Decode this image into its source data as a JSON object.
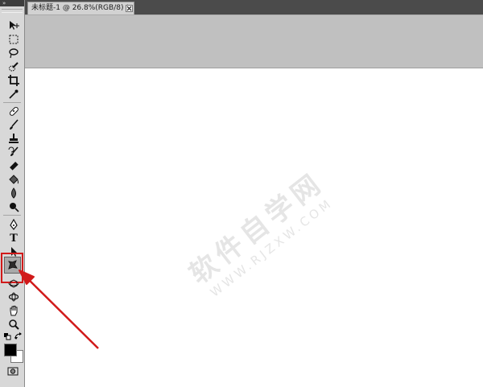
{
  "app": {
    "panel_header": "»"
  },
  "document_tab": {
    "title": "未标题-1 @ 26.8%(RGB/8) *"
  },
  "tools": [
    {
      "name": "move-tool"
    },
    {
      "name": "rectangular-marquee-tool"
    },
    {
      "name": "lasso-tool"
    },
    {
      "name": "quick-selection-tool"
    },
    {
      "name": "crop-tool"
    },
    {
      "name": "eyedropper-tool"
    },
    {
      "name": "spot-healing-brush-tool"
    },
    {
      "name": "brush-tool"
    },
    {
      "name": "clone-stamp-tool"
    },
    {
      "name": "history-brush-tool"
    },
    {
      "name": "eraser-tool"
    },
    {
      "name": "paint-bucket-tool"
    },
    {
      "name": "blur-tool"
    },
    {
      "name": "dodge-tool"
    },
    {
      "name": "pen-tool"
    },
    {
      "name": "type-tool",
      "glyph": "T"
    },
    {
      "name": "path-selection-tool"
    },
    {
      "name": "custom-shape-tool"
    },
    {
      "name": "3d-rotate-tool"
    },
    {
      "name": "3d-orbit-tool"
    },
    {
      "name": "hand-tool"
    },
    {
      "name": "zoom-tool"
    }
  ],
  "colors": {
    "foreground": "#000000",
    "background": "#ffffff",
    "highlight": "#d11a1a",
    "canvas": "#ffffff",
    "pasteboard": "#c0c0c0"
  },
  "watermark": {
    "main": "软件自学网",
    "sub": "WWW.RJZXW.COM"
  }
}
